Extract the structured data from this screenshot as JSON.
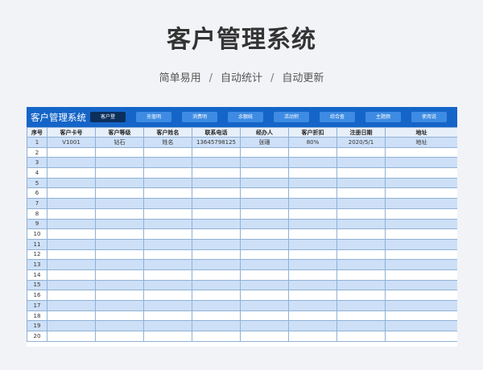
{
  "hero": {
    "title": "客户管理系统",
    "subtitle_parts": [
      "简单易用",
      "自动统计",
      "自动更新"
    ],
    "separator": "/"
  },
  "sheet": {
    "banner_title": "客户管理系统",
    "buttons": [
      "客户登",
      "充值明",
      "消费明",
      "余额统",
      "活动积",
      "综合查",
      "主题颜",
      "使用说"
    ],
    "active_button": 0,
    "headers": [
      "序号",
      "客户卡号",
      "客户等级",
      "客户姓名",
      "联系电话",
      "经办人",
      "客户折扣",
      "注册日期",
      "地址"
    ],
    "rows": [
      [
        "1",
        "V1001",
        "钻石",
        "姓名",
        "13645798125",
        "张珊",
        "80%",
        "2020/5/1",
        "地址"
      ],
      [
        "2",
        "",
        "",
        "",
        "",
        "",
        "",
        "",
        ""
      ],
      [
        "3",
        "",
        "",
        "",
        "",
        "",
        "",
        "",
        ""
      ],
      [
        "4",
        "",
        "",
        "",
        "",
        "",
        "",
        "",
        ""
      ],
      [
        "5",
        "",
        "",
        "",
        "",
        "",
        "",
        "",
        ""
      ],
      [
        "6",
        "",
        "",
        "",
        "",
        "",
        "",
        "",
        ""
      ],
      [
        "7",
        "",
        "",
        "",
        "",
        "",
        "",
        "",
        ""
      ],
      [
        "8",
        "",
        "",
        "",
        "",
        "",
        "",
        "",
        ""
      ],
      [
        "9",
        "",
        "",
        "",
        "",
        "",
        "",
        "",
        ""
      ],
      [
        "10",
        "",
        "",
        "",
        "",
        "",
        "",
        "",
        ""
      ],
      [
        "11",
        "",
        "",
        "",
        "",
        "",
        "",
        "",
        ""
      ],
      [
        "12",
        "",
        "",
        "",
        "",
        "",
        "",
        "",
        ""
      ],
      [
        "13",
        "",
        "",
        "",
        "",
        "",
        "",
        "",
        ""
      ],
      [
        "14",
        "",
        "",
        "",
        "",
        "",
        "",
        "",
        ""
      ],
      [
        "15",
        "",
        "",
        "",
        "",
        "",
        "",
        "",
        ""
      ],
      [
        "16",
        "",
        "",
        "",
        "",
        "",
        "",
        "",
        ""
      ],
      [
        "17",
        "",
        "",
        "",
        "",
        "",
        "",
        "",
        ""
      ],
      [
        "18",
        "",
        "",
        "",
        "",
        "",
        "",
        "",
        ""
      ],
      [
        "19",
        "",
        "",
        "",
        "",
        "",
        "",
        "",
        ""
      ],
      [
        "20",
        "",
        "",
        "",
        "",
        "",
        "",
        "",
        ""
      ]
    ]
  },
  "colors": {
    "banner": "#1565c8",
    "button": "#3d8be3",
    "button_active": "#0c2f5c",
    "row_stripe": "#cde0f7",
    "grid_line": "#8fb1d6"
  }
}
